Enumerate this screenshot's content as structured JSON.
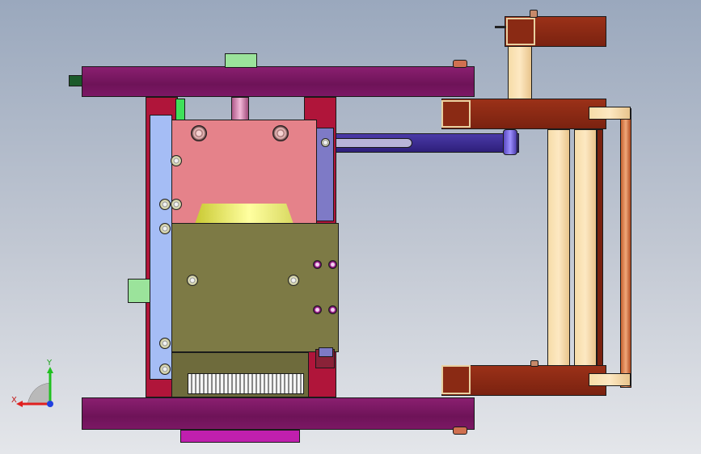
{
  "viewport": {
    "background_top": "#9aa8bd",
    "background_bottom": "#e4e6ea"
  },
  "axis_triad": {
    "x_label": "X",
    "y_label": "Y",
    "x_color": "#e02020",
    "y_color": "#20c020",
    "z_color": "#2040e0"
  },
  "model": {
    "plate_color": "#7c1865",
    "block_pink": "#e5828a",
    "block_olive": "#7d7a45",
    "side_plate_blue": "#a5bdf5",
    "slider_bar": "#3b2a8a",
    "frame_brown": "#7a2210",
    "post_cream": "#fde8c2",
    "pad_magenta": "#c01fae",
    "connector_green": "#9be39b"
  }
}
